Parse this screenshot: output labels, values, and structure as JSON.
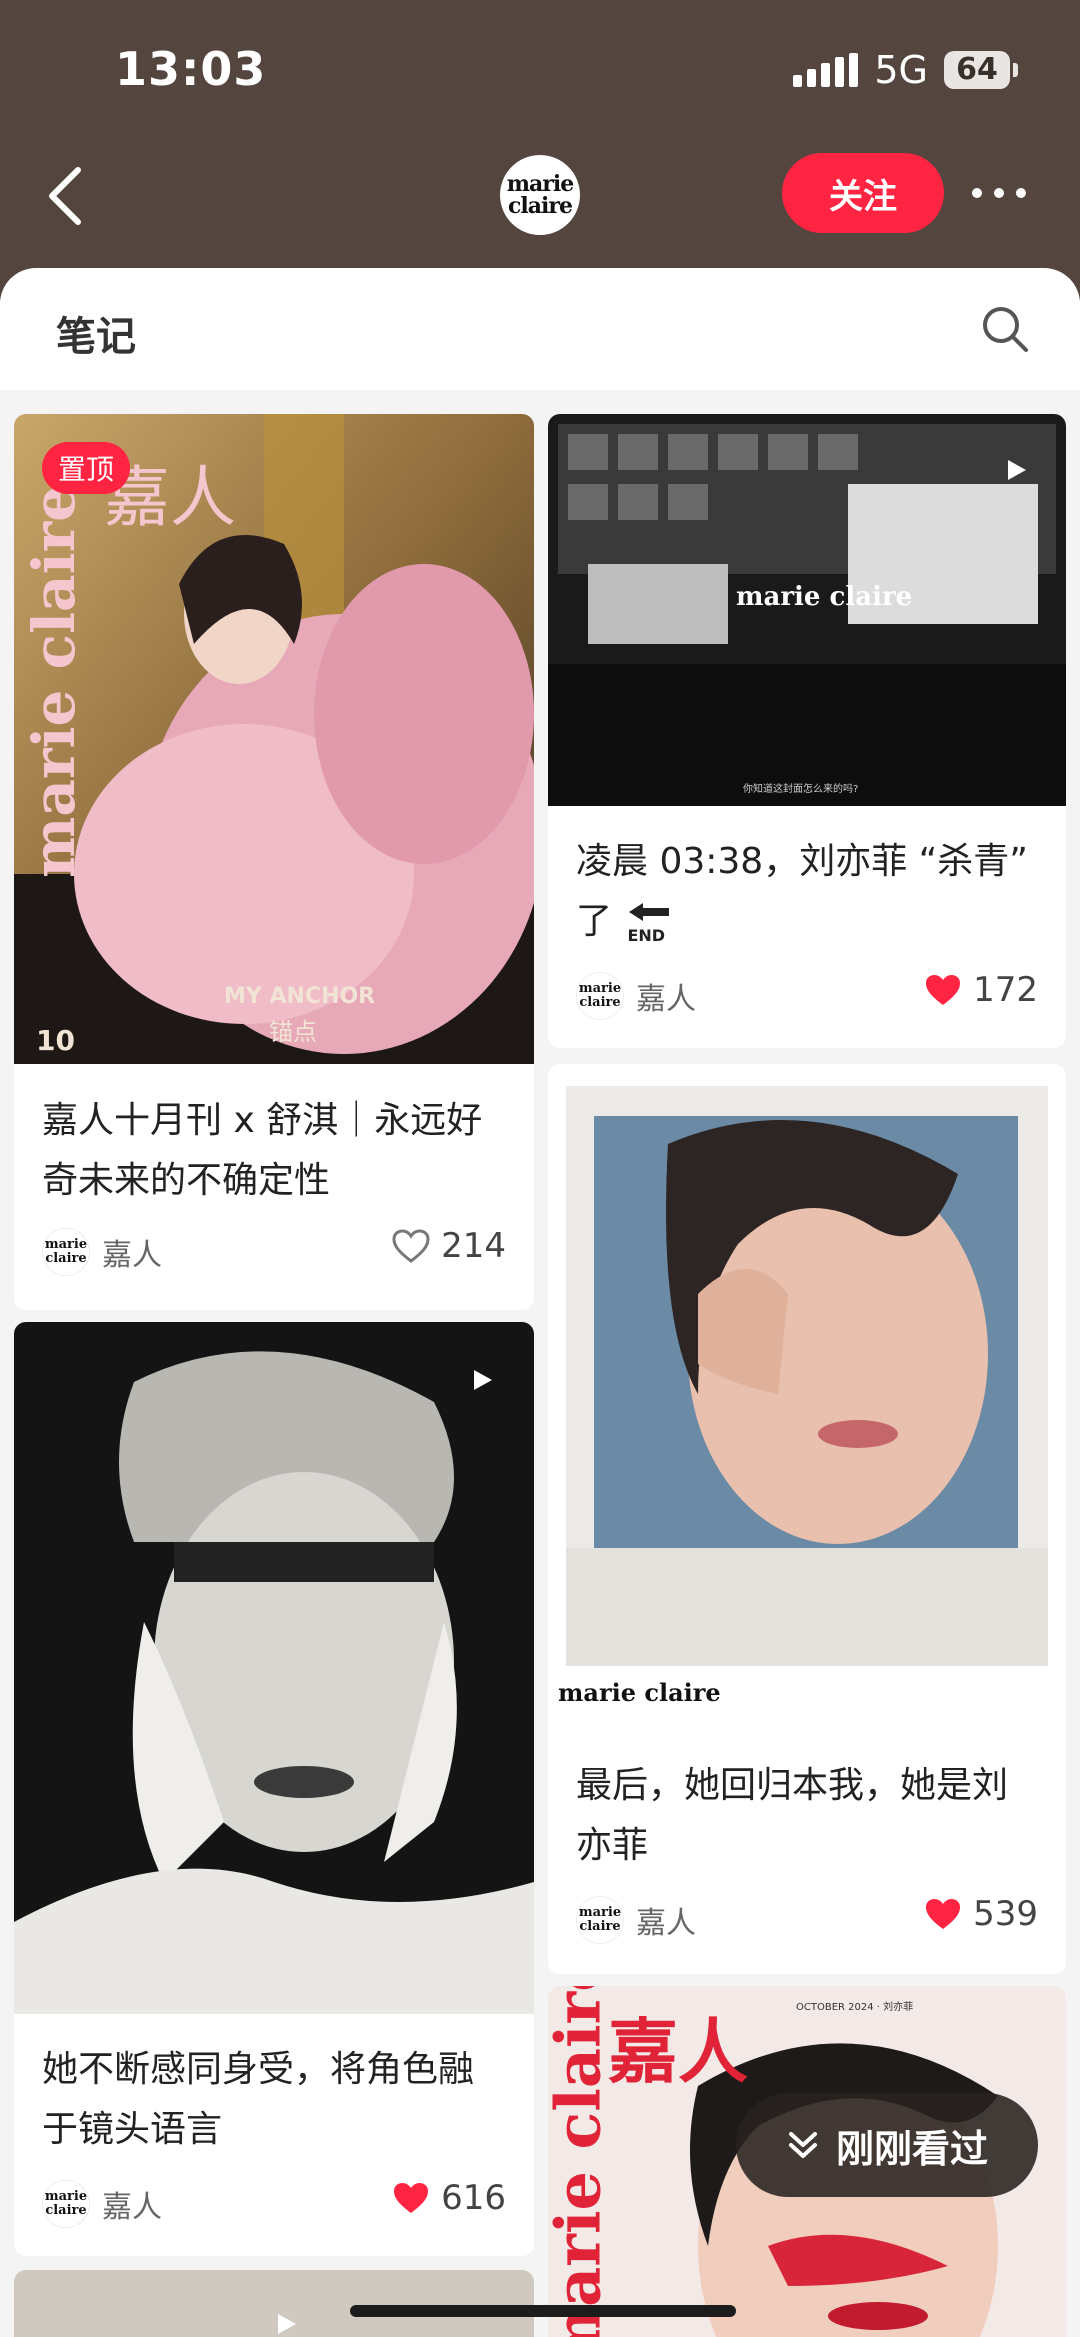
{
  "status": {
    "time": "13:03",
    "network": "5G",
    "battery": "64"
  },
  "header": {
    "logo_text": "marie claire",
    "follow_label": "关注"
  },
  "tabs": {
    "notes": "笔记"
  },
  "colors": {
    "accent": "#ff2442",
    "header_bg": "#54463f"
  },
  "cards": [
    {
      "id": "c1",
      "pinned_label": "置顶",
      "title": "嘉人十月刊 x 舒淇｜永远好奇未来的不确定性",
      "author": "嘉人",
      "likes": "214",
      "liked": false,
      "cover_text": {
        "mag": "marie claire",
        "jiaren": "嘉人",
        "cover_line_en": "MY ANCHOR",
        "cover_line_zh": "锚点",
        "issue": "10"
      }
    },
    {
      "id": "c2",
      "title": "凌晨 03:38，刘亦菲 “杀青” 了",
      "title_sticker": "END",
      "author": "嘉人",
      "likes": "172",
      "liked": true,
      "video": true,
      "cover_text": {
        "mag": "marie claire",
        "caption": "你知道这封面怎么来的吗?"
      }
    },
    {
      "id": "c3",
      "title": "最后，她回归本我，她是刘亦菲",
      "author": "嘉人",
      "likes": "539",
      "liked": true,
      "cover_text": {
        "mag": "marie claire"
      }
    },
    {
      "id": "c4",
      "title": "她不断感同身受，将角色融于镜头语言",
      "author": "嘉人",
      "likes": "616",
      "liked": true,
      "video": true
    },
    {
      "id": "c5",
      "cover_text": {
        "mag": "marie claire",
        "jiaren": "嘉人",
        "masthead_date": "OCTOBER 2024 · 刘亦菲"
      }
    }
  ],
  "recent": {
    "label": "刚刚看过"
  }
}
